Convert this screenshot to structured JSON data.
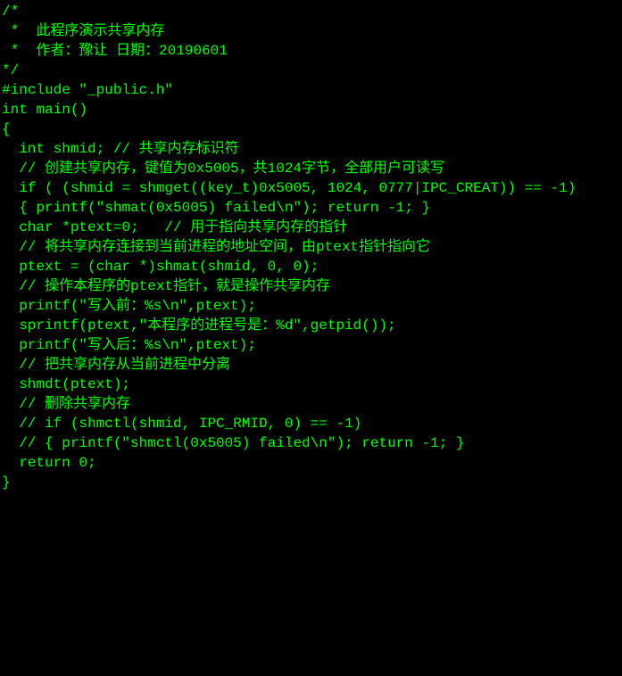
{
  "code": {
    "l1": "/*",
    "l2": " *  此程序演示共享内存",
    "l3": " *  作者：豫让 日期：20190601",
    "l4": "*/",
    "l5": "#include \"_public.h\"",
    "l6": "",
    "l7": "int main()",
    "l8": "{",
    "l9": "  int shmid; // 共享内存标识符",
    "l10": "",
    "l11": "  // 创建共享内存，键值为0x5005，共1024字节，全部用户可读写",
    "l12": "  if ( (shmid = shmget((key_t)0x5005, 1024, 0777|IPC_CREAT)) == -1)",
    "l13": "  { printf(\"shmat(0x5005) failed\\n\"); return -1; }",
    "l14": "",
    "l15": "  char *ptext=0;   // 用于指向共享内存的指针",
    "l16": "",
    "l17": "  // 将共享内存连接到当前进程的地址空间，由ptext指针指向它",
    "l18": "  ptext = (char *)shmat(shmid, 0, 0);",
    "l19": "",
    "l20": "  // 操作本程序的ptext指针，就是操作共享内存",
    "l21": "  printf(\"写入前：%s\\n\",ptext);",
    "l22": "  sprintf(ptext,\"本程序的进程号是：%d\",getpid());",
    "l23": "  printf(\"写入后：%s\\n\",ptext);",
    "l24": "",
    "l25": "  // 把共享内存从当前进程中分离",
    "l26": "  shmdt(ptext);",
    "l27": "",
    "l28": "  // 删除共享内存",
    "l29": "  // if (shmctl(shmid, IPC_RMID, 0) == -1)",
    "l30": "  // { printf(\"shmctl(0x5005) failed\\n\"); return -1; }",
    "l31": "",
    "l32": "  return 0;",
    "l33": "}"
  }
}
